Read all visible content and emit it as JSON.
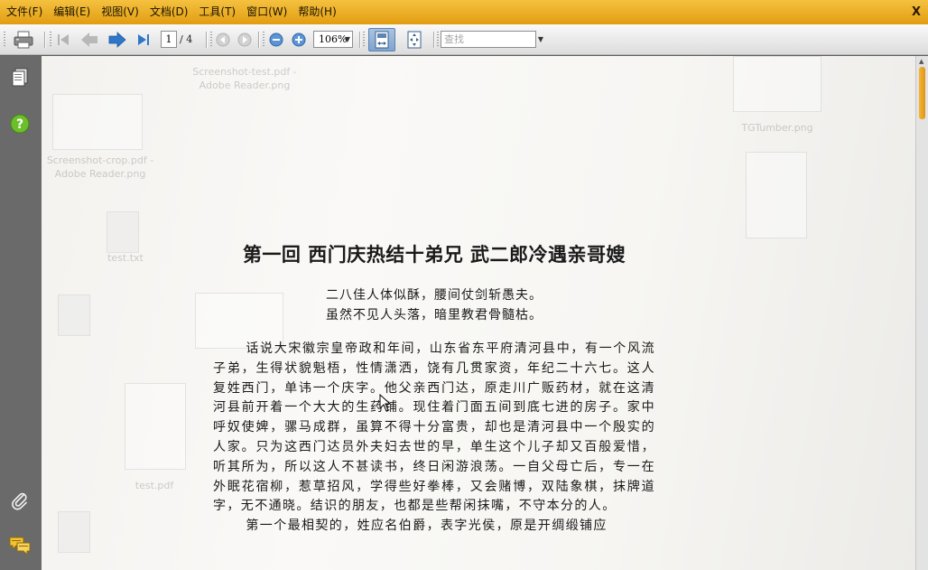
{
  "menu": {
    "items": [
      "文件(F)",
      "编辑(E)",
      "视图(V)",
      "文档(D)",
      "工具(T)",
      "窗口(W)",
      "帮助(H)"
    ],
    "close_label": "X"
  },
  "toolbar": {
    "current_page": "1",
    "page_total": "/ 4",
    "zoom": "106%",
    "search_placeholder": "查找",
    "icons": [
      "print-icon",
      "first-page-icon",
      "previous-page-icon",
      "next-page-icon",
      "last-page-icon",
      "back-icon",
      "forward-icon",
      "zoom-out-icon",
      "zoom-in-icon",
      "fit-width-icon",
      "fit-page-icon"
    ]
  },
  "sidepane": {
    "icons": [
      "pages-icon",
      "help-icon",
      "attachment-icon",
      "comments-icon"
    ]
  },
  "ghost_desktop": {
    "items": [
      "Screenshot-test.pdf - Adobe Reader.png",
      "Screenshot-crop.pdf - Adobe Reader.png",
      "TGTumber.png",
      "test.txt",
      "test.pdf"
    ]
  },
  "document": {
    "title": "第一回 西门庆热结十弟兄 武二郎冷遇亲哥嫂",
    "poem": [
      "二八佳人体似酥，腰间仗剑斩愚夫。",
      "虽然不见人头落，暗里教君骨髓枯。"
    ],
    "paragraph_1": "话说大宋徽宗皇帝政和年间，山东省东平府清河县中，有一个风流子弟，生得状貌魁梧，性情潇洒，饶有几贯家资，年纪二十六七。这人复姓西门，单讳一个庆字。他父亲西门达，原走川广贩药材，就在这清河县前开着一个大大的生药铺。现住着门面五间到底七进的房子。家中呼奴使婢，骡马成群，虽算不得十分富贵，却也是清河县中一个殷实的人家。只为这西门达员外夫妇去世的早，单生这个儿子却又百般爱惜，听其所为，所以这人不甚读书，终日闲游浪荡。一自父母亡后，专一在外眠花宿柳，惹草招风，学得些好拳棒，又会赌博，双陆象棋，抹牌道字，无不通晓。结识的朋友，也都是些帮闲抹嘴，不守本分的人。",
    "paragraph_2": "第一个最相契的，姓应名伯爵，表字光侯，原是开绸缎铺应"
  },
  "colors": {
    "menubar": "#e8a820",
    "page_background": "#f7f6f3",
    "sidepane": "#6a6a6a",
    "scroll_thumb": "#f0ad2e"
  }
}
